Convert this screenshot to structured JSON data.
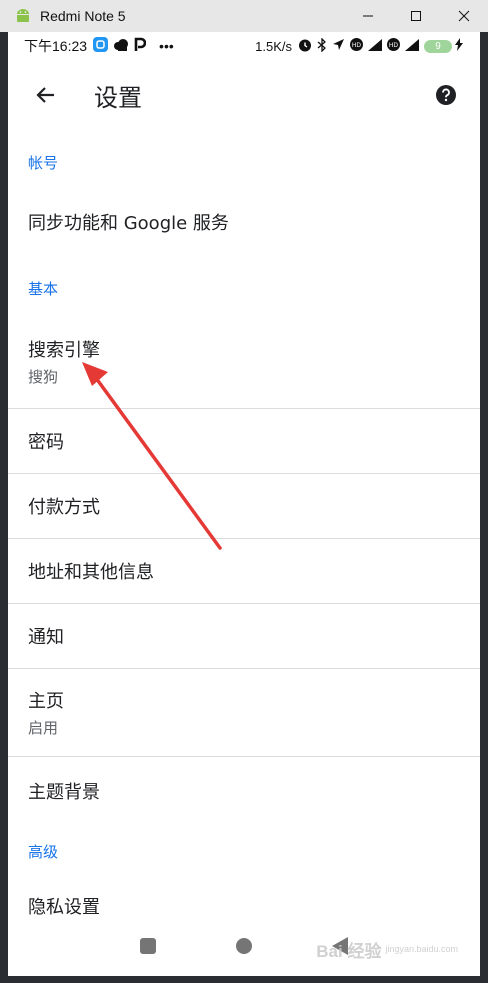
{
  "window": {
    "title": "Redmi Note 5"
  },
  "status_bar": {
    "time": "下午16:23",
    "dots": "•••",
    "speed": "1.5K/s",
    "battery": "9"
  },
  "app_bar": {
    "title": "设置"
  },
  "sections": [
    {
      "header": "帐号",
      "items": [
        {
          "label": "同步功能和 Google 服务"
        }
      ]
    },
    {
      "header": "基本",
      "items": [
        {
          "label": "搜索引擎",
          "sub": "搜狗"
        },
        {
          "label": "密码"
        },
        {
          "label": "付款方式"
        },
        {
          "label": "地址和其他信息"
        },
        {
          "label": "通知"
        },
        {
          "label": "主页",
          "sub": "启用"
        },
        {
          "label": "主题背景"
        }
      ]
    },
    {
      "header": "高级",
      "items": [
        {
          "label": "隐私设置"
        }
      ]
    }
  ],
  "watermark": {
    "main": "Bai 经验",
    "sub": "jingyan.baidu.com"
  },
  "colors": {
    "accent": "#1a73e8",
    "annotation_arrow": "#e53935",
    "divider": "#dadce0"
  },
  "icons": [
    "android-icon",
    "minimize-icon",
    "maximize-icon",
    "close-icon",
    "back-arrow-icon",
    "help-icon",
    "stop-nav-icon",
    "home-nav-icon",
    "back-nav-icon"
  ]
}
